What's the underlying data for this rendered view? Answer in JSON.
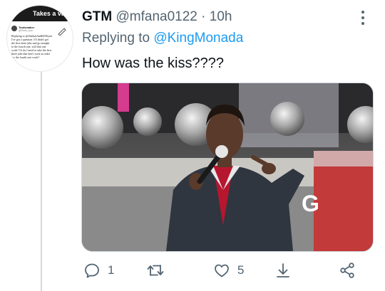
{
  "avatar": {
    "banner_text": "Takes a valid p",
    "name": "Toolsmaker",
    "handle": "@Tools_com",
    "body_lines": [
      "Replying to @thisthatAndKEPayne",
      "I've got a question. If I didn't get",
      "the first three jabs and go straight",
      "to the fourth one, will that one",
      "work? Or do I need to take the first",
      "three jabs that don't work in order",
      "for the fourth one work?"
    ]
  },
  "tweet": {
    "name": "GTM",
    "handle": "@mfana0122",
    "separator": "·",
    "time": "10h",
    "replying_prefix": "Replying to ",
    "replying_to": "@KingMonada",
    "text": "How was the kiss????"
  },
  "media": {
    "sign_text": "G"
  },
  "actions": {
    "reply_count": "1",
    "retweet_count": "",
    "like_count": "5"
  },
  "colors": {
    "accent": "#1d9bf0",
    "secondary_text": "#536471"
  }
}
